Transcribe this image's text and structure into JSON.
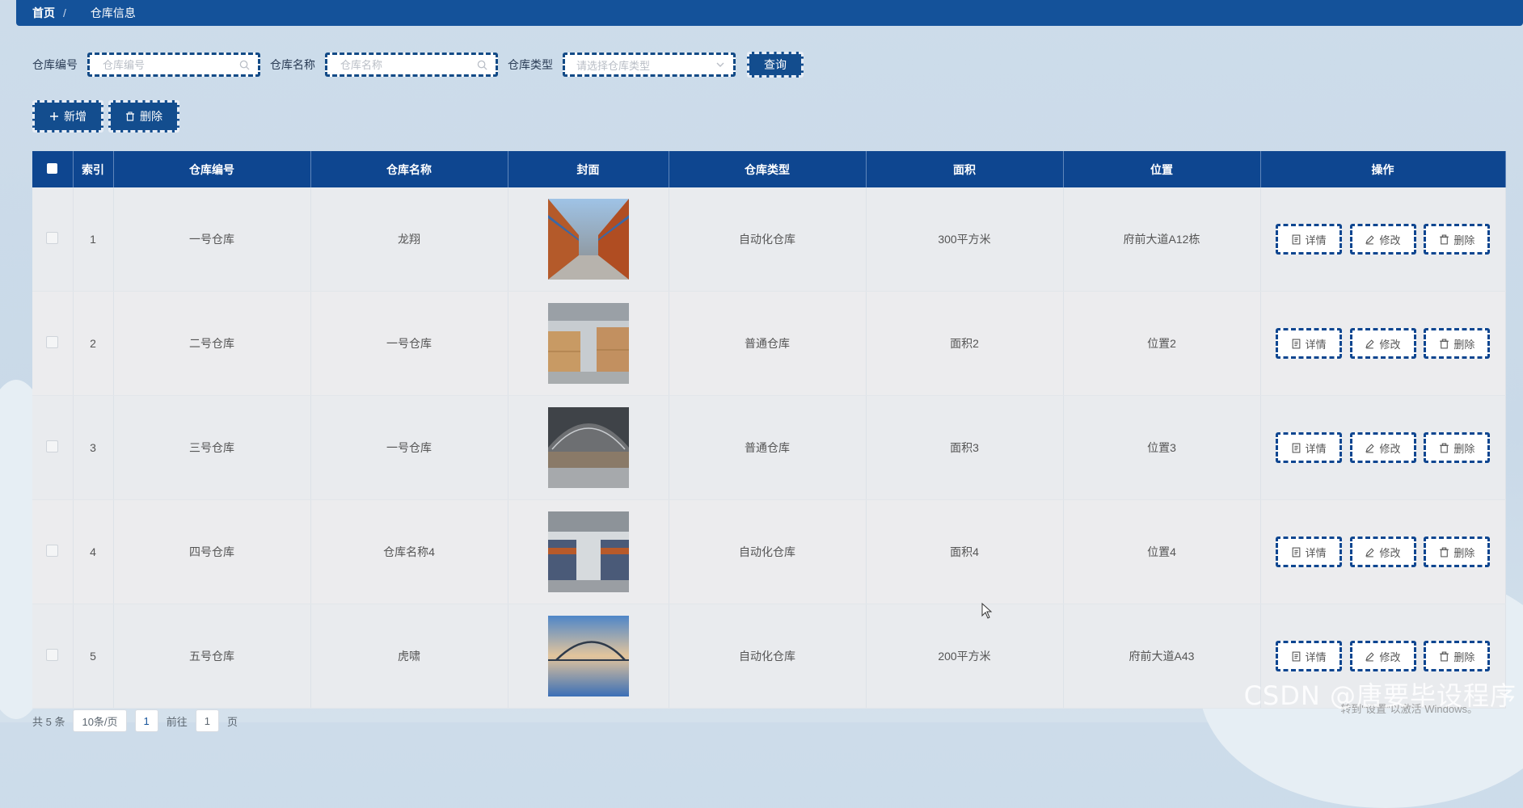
{
  "breadcrumb": {
    "home": "首页",
    "separator": "/",
    "current": "仓库信息"
  },
  "search": {
    "code_label": "仓库编号",
    "code_placeholder": "仓库编号",
    "name_label": "仓库名称",
    "name_placeholder": "仓库名称",
    "type_label": "仓库类型",
    "type_placeholder": "请选择仓库类型",
    "query_button": "查询"
  },
  "actions": {
    "add_label": "新增",
    "delete_label": "删除"
  },
  "table": {
    "headers": [
      "索引",
      "仓库编号",
      "仓库名称",
      "封面",
      "仓库类型",
      "面积",
      "位置",
      "操作"
    ],
    "rows": [
      {
        "index": "1",
        "code": "一号仓库",
        "name": "龙翔",
        "type": "自动化仓库",
        "area": "300平方米",
        "location": "府前大道A12栋",
        "cover": "warehouse-shelves-image"
      },
      {
        "index": "2",
        "code": "二号仓库",
        "name": "一号仓库",
        "type": "普通仓库",
        "area": "面积2",
        "location": "位置2",
        "cover": "warehouse-boxes-image"
      },
      {
        "index": "3",
        "code": "三号仓库",
        "name": "一号仓库",
        "type": "普通仓库",
        "area": "面积3",
        "location": "位置3",
        "cover": "warehouse-hall-image"
      },
      {
        "index": "4",
        "code": "四号仓库",
        "name": "仓库名称4",
        "type": "自动化仓库",
        "area": "面积4",
        "location": "位置4",
        "cover": "warehouse-racks-image"
      },
      {
        "index": "5",
        "code": "五号仓库",
        "name": "虎啸",
        "type": "自动化仓库",
        "area": "200平方米",
        "location": "府前大道A43",
        "cover": "bridge-sunset-image"
      }
    ],
    "ops": {
      "detail": "详情",
      "edit": "修改",
      "delete": "删除"
    }
  },
  "pagination": {
    "total": "共 5 条",
    "page_size": "10条/页",
    "current_page": "1",
    "goto_prefix": "前往",
    "goto_value": "1",
    "goto_suffix": "页"
  },
  "watermark": {
    "text": "CSDN @唐要毕设程序",
    "activate": "转到\"设置\"以激活 Windows。"
  },
  "colors": {
    "primary": "#134d8e",
    "header": "#0e4690",
    "topbar": "#14529a"
  }
}
